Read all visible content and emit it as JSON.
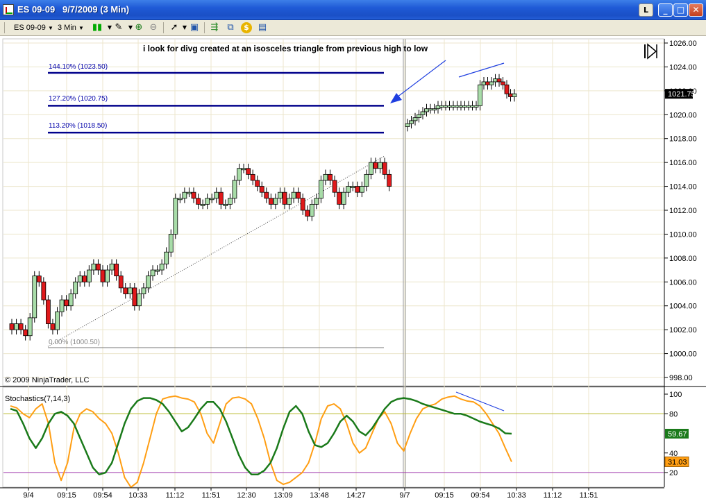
{
  "window": {
    "title": "ES 09-09   9/7/2009 (3 Min)",
    "btn_l": "L",
    "btn_min": "_",
    "btn_max": "□",
    "btn_close": "✕"
  },
  "toolbar": {
    "instrument": "ES 09-09",
    "interval": "3 Min",
    "icons": [
      "candlestick-icon",
      "pencil-icon",
      "zoom-in-icon",
      "zoom-out-icon",
      "cursor-icon",
      "properties-icon",
      "strategy-icon",
      "indicator-icon",
      "dollar-icon",
      "data-box-icon"
    ]
  },
  "annotation": "i look for divg created at an isosceles triangle from previous high to low",
  "copyright": "© 2009 NinjaTrader, LLC",
  "colors": {
    "up_candle": "#a8dca8",
    "down_candle": "#e0191b",
    "fib_line": "#00008b",
    "stoch_k": "#ff9e13",
    "stoch_d": "#1a7a1a",
    "upper_band": "#b8b828",
    "lower_band": "#9b2fa9",
    "annotation_arrow": "#1f3fe0"
  },
  "chart_data": [
    {
      "type": "candlestick",
      "instrument": "ES 09-09",
      "interval": "3 Min",
      "ylim": [
        997,
        1026.5
      ],
      "y_ticks": [
        "1026.00",
        "1024.00",
        "1022.00",
        "1020.00",
        "1018.00",
        "1016.00",
        "1014.00",
        "1012.00",
        "1010.00",
        "1008.00",
        "1006.00",
        "1004.00",
        "1002.00",
        "1000.00",
        "998.00"
      ],
      "x_ticks": [
        "9/4",
        "09:15",
        "09:54",
        "10:33",
        "11:12",
        "11:51",
        "12:30",
        "13:09",
        "13:48",
        "14:27",
        "9/7",
        "09:15",
        "09:54",
        "10:33",
        "11:12",
        "11:51"
      ],
      "last_price": "1021.75",
      "fib_levels": [
        {
          "label": "144.10% (1023.50)",
          "value": 1023.5
        },
        {
          "label": "127.20% (1020.75)",
          "value": 1020.75
        },
        {
          "label": "113.20% (1018.50)",
          "value": 1018.5
        },
        {
          "label": "0.00% (1000.50)",
          "value": 1000.5
        }
      ],
      "closes": [
        1002.0,
        1002.5,
        1002.0,
        1001.5,
        1003.0,
        1006.5,
        1006.0,
        1004.5,
        1002.5,
        1002.0,
        1003.5,
        1004.5,
        1004.0,
        1005.0,
        1006.0,
        1006.5,
        1006.0,
        1007.0,
        1007.5,
        1007.0,
        1006.0,
        1007.0,
        1007.5,
        1006.5,
        1005.5,
        1005.0,
        1005.5,
        1004.0,
        1005.0,
        1005.5,
        1006.5,
        1007.0,
        1007.0,
        1007.5,
        1008.5,
        1010.0,
        1013.0,
        1013.0,
        1013.5,
        1013.5,
        1013.0,
        1012.5,
        1012.5,
        1013.0,
        1013.0,
        1013.5,
        1012.5,
        1012.5,
        1013.0,
        1014.5,
        1015.5,
        1015.5,
        1015.0,
        1014.5,
        1014.0,
        1013.5,
        1013.0,
        1012.5,
        1013.0,
        1013.5,
        1012.5,
        1013.0,
        1013.5,
        1013.0,
        1012.0,
        1011.5,
        1012.5,
        1013.0,
        1014.5,
        1015.0,
        1014.5,
        1013.5,
        1012.5,
        1013.5,
        1014.0,
        1014.0,
        1013.5,
        1014.0,
        1015.0,
        1016.0,
        1015.5,
        1016.0,
        1015.0,
        1014.0
      ],
      "closes_day2": [
        1019.25,
        1019.5,
        1019.75,
        1020.0,
        1020.25,
        1020.5,
        1020.5,
        1020.5,
        1020.75,
        1020.75,
        1020.75,
        1020.75,
        1020.75,
        1020.75,
        1020.75,
        1020.75,
        1020.75,
        1020.75,
        1020.75,
        1022.5,
        1022.75,
        1022.5,
        1022.75,
        1023.0,
        1022.75,
        1022.5,
        1021.75,
        1021.5,
        1021.75
      ]
    },
    {
      "type": "line",
      "title": "Stochastics(7,14,3)",
      "ylim": [
        0,
        100
      ],
      "y_ticks": [
        "100",
        "80",
        "40",
        "20"
      ],
      "bands": [
        80,
        20
      ],
      "series": [
        {
          "name": "K",
          "last_label": "31.03",
          "values": [
            88,
            86,
            80,
            76,
            85,
            90,
            70,
            30,
            12,
            30,
            65,
            80,
            85,
            82,
            75,
            70,
            60,
            40,
            15,
            5,
            10,
            30,
            55,
            80,
            95,
            97,
            98,
            96,
            95,
            92,
            80,
            60,
            50,
            70,
            90,
            96,
            97,
            95,
            90,
            75,
            55,
            30,
            12,
            8,
            10,
            15,
            20,
            30,
            50,
            75,
            88,
            90,
            85,
            70,
            50,
            40,
            45,
            60,
            75,
            82,
            70,
            50,
            42,
            60,
            75,
            85,
            88,
            90,
            95,
            97,
            98,
            95,
            93,
            92,
            88,
            80,
            70,
            60,
            45,
            31
          ]
        },
        {
          "name": "D",
          "last_label": "59.67",
          "values": [
            85,
            83,
            70,
            55,
            45,
            55,
            70,
            80,
            82,
            78,
            70,
            55,
            40,
            25,
            18,
            20,
            30,
            50,
            70,
            85,
            93,
            96,
            96,
            94,
            90,
            82,
            72,
            62,
            66,
            75,
            85,
            92,
            92,
            85,
            72,
            55,
            38,
            25,
            18,
            18,
            22,
            30,
            45,
            65,
            82,
            88,
            80,
            62,
            48,
            46,
            50,
            60,
            72,
            78,
            72,
            62,
            58,
            65,
            75,
            85,
            92,
            95,
            96,
            95,
            93,
            90,
            88,
            86,
            84,
            82,
            80,
            80,
            78,
            75,
            72,
            70,
            68,
            65,
            60,
            59.67
          ]
        }
      ]
    }
  ]
}
